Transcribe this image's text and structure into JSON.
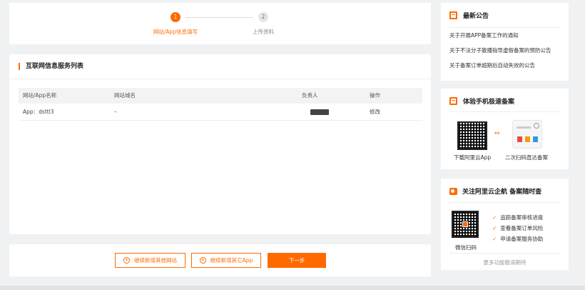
{
  "steps": {
    "items": [
      {
        "number": "1",
        "label": "网站/App信息填写"
      },
      {
        "number": "2",
        "label": "上传资料"
      }
    ]
  },
  "service_list": {
    "title": "互联网信息服务列表",
    "columns": [
      "网站/App名称",
      "网站域名",
      "负责人",
      "操作"
    ],
    "rows": [
      {
        "name": "App：dsttl3",
        "domain": "–",
        "owner": "",
        "action": "修改"
      }
    ]
  },
  "actions": {
    "add_website": "继续新增其他网站",
    "add_app": "继续新增其它App",
    "next": "下一步",
    "plus_symbol": "+"
  },
  "notice": {
    "title": "最新公告",
    "items": [
      "关于开展APP备案工作的通知",
      "关于不法分子散播指导虚假备案的预防公告",
      "关于备案订单超期后自动失效的公告"
    ]
  },
  "mobile": {
    "title": "体验手机极速备案",
    "download_caption": "下载阿里云App",
    "scan_caption": "二次扫码直达备案",
    "arrows_symbol": "↔"
  },
  "follow": {
    "title": "关注阿里云企航 备案随时查",
    "scan_caption": "微信扫码",
    "features": [
      "追踪备案审核进度",
      "查看备案订单风险",
      "申请备案服务协助"
    ],
    "check_symbol": "✓",
    "more": "更多功能敬请期待"
  },
  "colors": {
    "accent": "#ff6a00",
    "background": "#f0f1f3"
  }
}
